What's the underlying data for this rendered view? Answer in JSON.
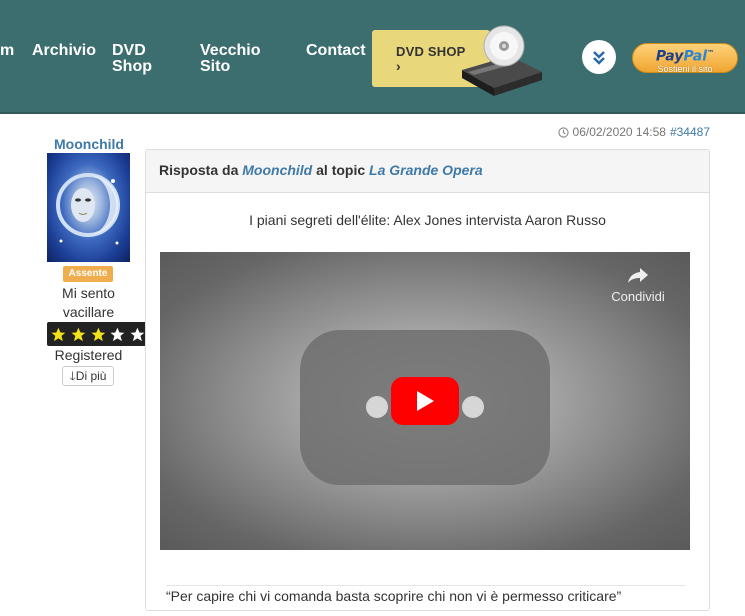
{
  "nav": {
    "partial_item": "m",
    "archivio": "Archivio",
    "dvd_shop_line1": "DVD",
    "dvd_shop_line2": "Shop",
    "vecchio_line1": "Vecchio",
    "vecchio_line2": "Sito",
    "contact": "Contact"
  },
  "dvd_banner": {
    "label": "DVD SHOP",
    "arrow": "›"
  },
  "paypal": {
    "brand_a": "Pay",
    "brand_b": "Pal",
    "tm": "™",
    "sub": "Sostieni il sito"
  },
  "post": {
    "date": "06/02/2020 14:58",
    "id": "#34487",
    "header_prefix": "Risposta da",
    "author_link": "Moonchild",
    "header_mid": "al topic",
    "topic_link": "La Grande Opera",
    "intro": "I piani segreti dell'élite: Alex Jones intervista Aaron Russo",
    "share_label": "Condividi",
    "quote": "“Per capire chi vi comanda basta scoprire chi non vi è permesso criticare”"
  },
  "author": {
    "name": "Moonchild",
    "status": "Assente",
    "title": "Mi sento vacillare",
    "rating_stars": 3,
    "rating_max": 5,
    "rank": "Registered",
    "more_label": "Di più"
  },
  "colors": {
    "header_bg": "#3c6e6f",
    "link": "#3f79a8",
    "badge": "#f0ad4e",
    "dvd_banner": "#e9d77c",
    "youtube_red": "#ff0000"
  }
}
